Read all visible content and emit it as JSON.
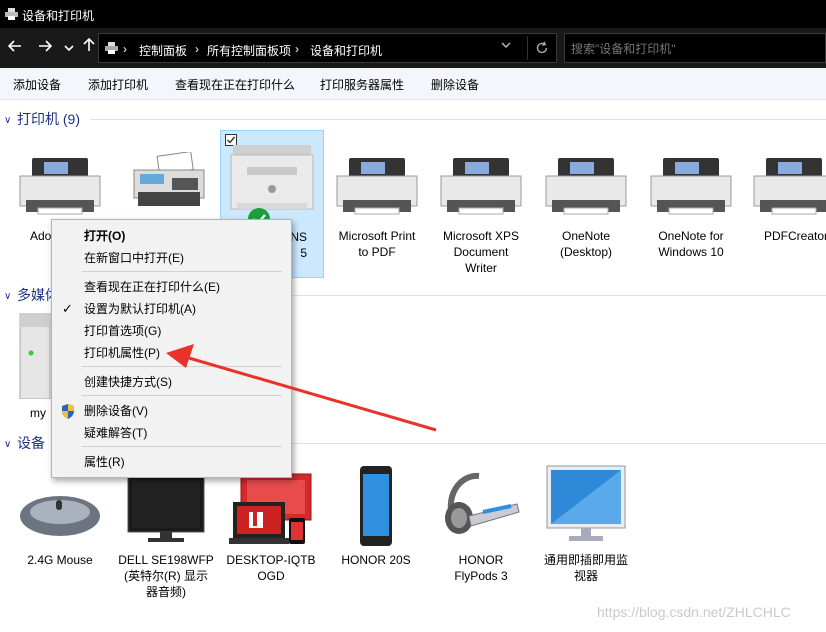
{
  "window": {
    "title": "设备和打印机"
  },
  "nav": {
    "back_icon": "arrow-left-icon",
    "forward_icon": "arrow-right-icon",
    "recent_icon": "chevron-down-icon",
    "up_icon": "arrow-up-icon",
    "breadcrumb": [
      "控制面板",
      "所有控制面板项",
      "设备和打印机"
    ],
    "breadcrumb_separator": "›",
    "search_placeholder": "搜索\"设备和打印机\""
  },
  "commands": [
    "添加设备",
    "添加打印机",
    "查看现在正在打印什么",
    "打印服务器属性",
    "删除设备"
  ],
  "groups": {
    "printers": {
      "header": "打印机 (9)",
      "items": [
        {
          "label": "Ado",
          "icon": "printer-icon"
        },
        {
          "label": "",
          "icon": "fax-icon"
        },
        {
          "label": "NS\n5",
          "icon": "laser-printer-icon",
          "selected": true,
          "default": true
        },
        {
          "label": "Microsoft Print\nto PDF",
          "icon": "printer-icon"
        },
        {
          "label": "Microsoft XPS\nDocument\nWriter",
          "icon": "printer-icon"
        },
        {
          "label": "OneNote\n(Desktop)",
          "icon": "printer-icon"
        },
        {
          "label": "OneNote for\nWindows 10",
          "icon": "printer-icon"
        },
        {
          "label": "PDFCreator",
          "icon": "printer-icon"
        }
      ]
    },
    "multimedia": {
      "header": "多媒体",
      "items": [
        {
          "label": "my",
          "icon": "media-server-icon"
        }
      ]
    },
    "devices": {
      "header": "设备",
      "items": [
        {
          "label": "2.4G Mouse",
          "icon": "mouse-icon"
        },
        {
          "label": "DELL SE198WFP\n(英特尔(R) 显示\n器音频)",
          "icon": "monitor-icon"
        },
        {
          "label": "DESKTOP-IQTB\nOGD",
          "icon": "computer-icon"
        },
        {
          "label": "HONOR 20S",
          "icon": "phone-icon"
        },
        {
          "label": "HONOR\nFlyPods 3",
          "icon": "headset-icon"
        },
        {
          "label": "通用即插即用监\n视器",
          "icon": "monitor-icon"
        }
      ]
    }
  },
  "context_menu": {
    "items": [
      {
        "label": "打开(O)",
        "bold": true
      },
      {
        "label": "在新窗口中打开(E)"
      },
      {
        "label": "查看现在正在打印什么(E)"
      },
      {
        "label": "设置为默认打印机(A)",
        "checked": true
      },
      {
        "label": "打印首选项(G)"
      },
      {
        "label": "打印机属性(P)"
      },
      {
        "label": "创建快捷方式(S)"
      },
      {
        "label": "删除设备(V)",
        "icon": "shield-icon"
      },
      {
        "label": "疑难解答(T)"
      },
      {
        "label": "属性(R)"
      }
    ]
  },
  "annotation": {
    "color": "#e8332a"
  },
  "watermark": "https://blog.csdn.net/ZHLCHLC",
  "colors": {
    "titlebar": "#000000",
    "navbar": "#191919",
    "header_text": "#1e3287",
    "selection": "#cce8ff"
  }
}
